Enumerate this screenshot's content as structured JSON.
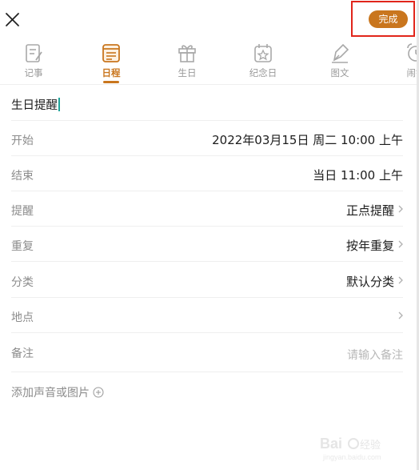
{
  "header": {
    "close_icon": "close-icon",
    "done_label": "完成",
    "done_color": "#c9761e",
    "highlight_color": "#e1251b"
  },
  "tabs": [
    {
      "label": "记事",
      "icon": "note-icon",
      "active": false
    },
    {
      "label": "日程",
      "icon": "schedule-icon",
      "active": true
    },
    {
      "label": "生日",
      "icon": "gift-icon",
      "active": false
    },
    {
      "label": "纪念日",
      "icon": "anniversary-calendar-icon",
      "active": false
    },
    {
      "label": "图文",
      "icon": "pen-icon",
      "active": false
    },
    {
      "label": "闹钟",
      "icon": "alarm-clock-icon",
      "active": false
    }
  ],
  "event": {
    "title": "生日提醒"
  },
  "fields": [
    {
      "label": "开始",
      "value": "2022年03月15日 周二 10:00 上午",
      "chevron": false
    },
    {
      "label": "结束",
      "value": "当日 11:00 上午",
      "chevron": false
    },
    {
      "label": "提醒",
      "value": "正点提醒",
      "chevron": true
    },
    {
      "label": "重复",
      "value": "按年重复",
      "chevron": true
    },
    {
      "label": "分类",
      "value": "默认分类",
      "chevron": true
    },
    {
      "label": "地点",
      "value": "",
      "chevron": true
    },
    {
      "label": "备注",
      "placeholder": "请输入备注",
      "chevron": false
    }
  ],
  "add_media": {
    "label": "添加声音或图片",
    "icon": "add-circle-icon"
  },
  "accent_color": "#c9761e"
}
